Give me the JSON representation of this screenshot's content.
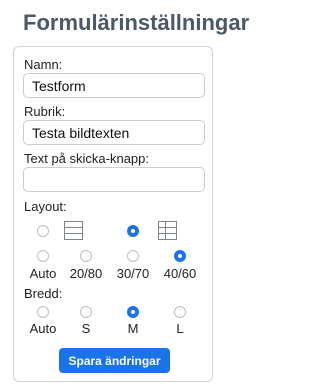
{
  "page_title": "Formulärinställningar",
  "form": {
    "name": {
      "label": "Namn:",
      "value": "Testform"
    },
    "heading": {
      "label": "Rubrik:",
      "value": "Testa bildtexten"
    },
    "submit_text": {
      "label": "Text på skicka-knapp:",
      "value": ""
    },
    "layout": {
      "label": "Layout:",
      "options": [
        "Auto",
        "20/80",
        "30/70",
        "40/60"
      ],
      "selected": "40/60",
      "preview_options": [
        "stacked",
        "side-by-side"
      ],
      "preview_selected": "side-by-side"
    },
    "width": {
      "label": "Bredd:",
      "options": [
        "Auto",
        "S",
        "M",
        "L"
      ],
      "selected": "M"
    },
    "save_label": "Spara ändringar"
  },
  "colors": {
    "accent": "#1a73e8",
    "title": "#4a5868"
  }
}
